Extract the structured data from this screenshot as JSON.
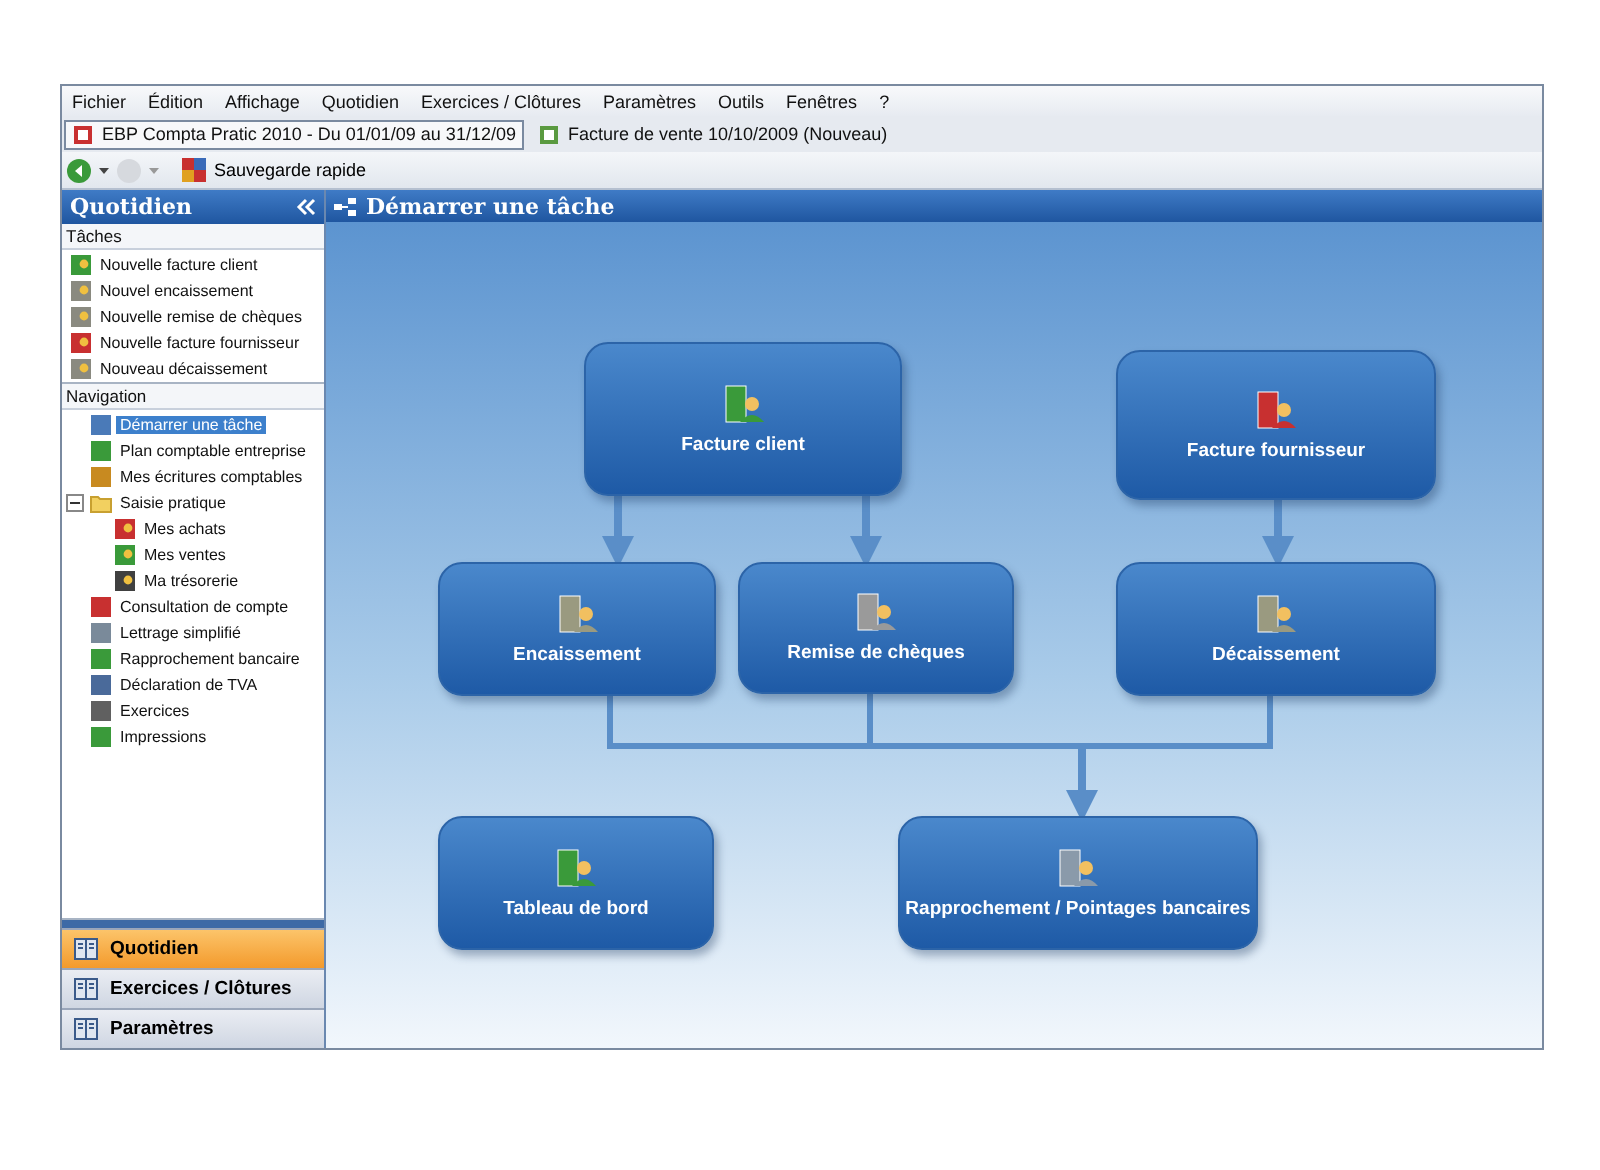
{
  "menu": [
    "Fichier",
    "Édition",
    "Affichage",
    "Quotidien",
    "Exercices / Clôtures",
    "Paramètres",
    "Outils",
    "Fenêtres",
    "?"
  ],
  "doc_tabs": [
    {
      "label": "EBP Compta Pratic 2010 - Du 01/01/09 au 31/12/09",
      "selected": true
    },
    {
      "label": "Facture de vente 10/10/2009 (Nouveau)",
      "selected": false
    }
  ],
  "toolbar": {
    "save_label": "Sauvegarde rapide"
  },
  "sidebar": {
    "title": "Quotidien",
    "tasks": {
      "heading": "Tâches",
      "items": [
        "Nouvelle facture client",
        "Nouvel encaissement",
        "Nouvelle remise de chèques",
        "Nouvelle facture fournisseur",
        "Nouveau décaissement"
      ]
    },
    "navigation": {
      "heading": "Navigation",
      "items": [
        {
          "label": "Démarrer une tâche",
          "selected": true
        },
        {
          "label": "Plan comptable entreprise",
          "selected": false
        },
        {
          "label": "Mes écritures comptables",
          "selected": false
        },
        {
          "label": "Saisie pratique",
          "selected": false,
          "expanded": true,
          "children": [
            {
              "label": "Mes achats",
              "selected": false
            },
            {
              "label": "Mes ventes",
              "selected": false
            },
            {
              "label": "Ma trésorerie",
              "selected": false
            }
          ]
        },
        {
          "label": "Consultation de compte",
          "selected": false
        },
        {
          "label": "Lettrage simplifié",
          "selected": false
        },
        {
          "label": "Rapprochement bancaire",
          "selected": false
        },
        {
          "label": "Déclaration de TVA",
          "selected": false
        },
        {
          "label": "Exercices",
          "selected": false
        },
        {
          "label": "Impressions",
          "selected": false
        }
      ]
    },
    "sections": [
      {
        "label": "Quotidien",
        "selected": true
      },
      {
        "label": "Exercices / Clôtures",
        "selected": false
      },
      {
        "label": "Paramètres",
        "selected": false
      }
    ]
  },
  "main": {
    "title": "Démarrer une tâche",
    "nodes": [
      "Facture client",
      "Facture fournisseur",
      "Encaissement",
      "Remise de chèques",
      "Décaissement",
      "Tableau de bord",
      "Rapprochement / Pointages bancaires"
    ]
  }
}
